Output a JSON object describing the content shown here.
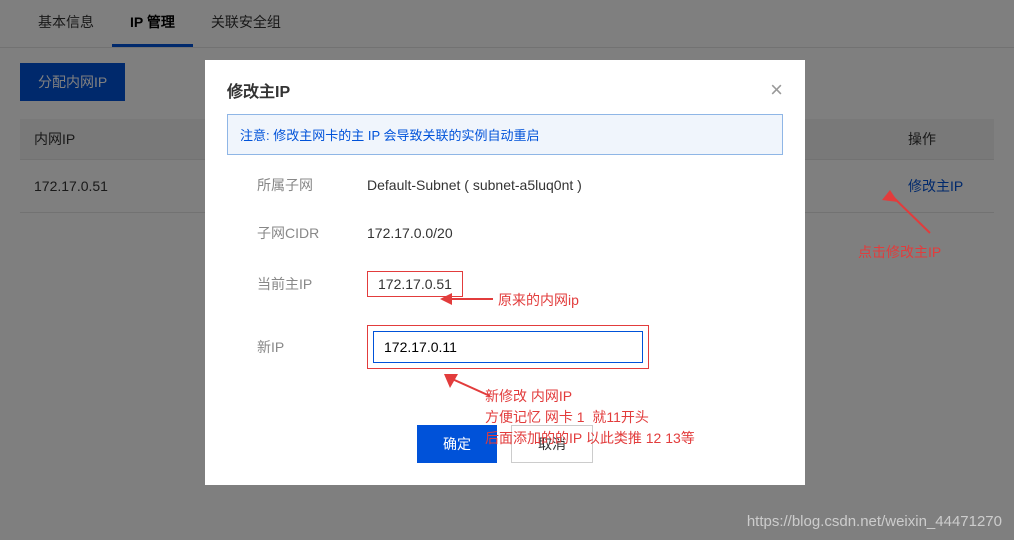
{
  "tabs": {
    "basic": "基本信息",
    "ip": "IP 管理",
    "sg": "关联安全组"
  },
  "alloc_btn": "分配内网IP",
  "table": {
    "col_ip": "内网IP",
    "col_ops": "操作",
    "row": {
      "ip": "172.17.0.51",
      "action": "修改主IP"
    }
  },
  "modal": {
    "title": "修改主IP",
    "notice": "注意: 修改主网卡的主 IP 会导致关联的实例自动重启",
    "subnet_label": "所属子网",
    "subnet_value": "Default-Subnet ( subnet-a5luq0nt )",
    "cidr_label": "子网CIDR",
    "cidr_value": "172.17.0.0/20",
    "curip_label": "当前主IP",
    "curip_value": "172.17.0.51",
    "newip_label": "新IP",
    "newip_value": "172.17.0.11",
    "ok": "确定",
    "cancel": "取消"
  },
  "annotations": {
    "a1": "点击修改主IP",
    "a2": "原来的内网ip",
    "a3": "新修改 内网IP\n方便记忆 网卡 1  就11开头\n后面添加的的IP 以此类推 12 13等"
  },
  "watermark": "https://blog.csdn.net/weixin_44471270"
}
